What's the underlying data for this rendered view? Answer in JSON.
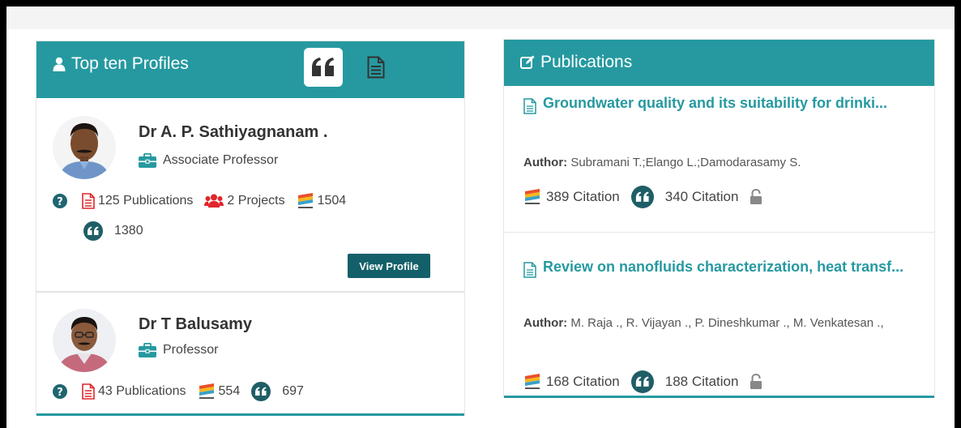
{
  "profiles_panel": {
    "title": "Top ten Profiles",
    "tabs": [
      "quote-tab",
      "document-tab"
    ],
    "profiles": [
      {
        "name": "Dr A. P. Sathiyagnanam .",
        "role": "Associate Professor",
        "publications": "125 Publications",
        "projects": "2 Projects",
        "dimensions_count": "1504",
        "citations_count": "1380",
        "button": "View Profile"
      },
      {
        "name": "Dr T Balusamy",
        "role": "Professor",
        "publications": "43 Publications",
        "dimensions_count": "554",
        "citations_count": "697"
      }
    ]
  },
  "publications_panel": {
    "title": "Publications",
    "items": [
      {
        "title": "Groundwater quality and its suitability for drinki...",
        "author_label": "Author:",
        "authors": "Subramani T.;Elango L.;Damodarasamy S.",
        "citation_a": "389 Citation",
        "citation_b": "340 Citation"
      },
      {
        "title": "Review on nanofluids characterization, heat transf...",
        "author_label": "Author:",
        "authors": "M. Raja ., R. Vijayan ., P. Dineshkumar ., M. Venkatesan .,",
        "citation_a": "168 Citation",
        "citation_b": "188 Citation"
      }
    ]
  },
  "colors": {
    "teal": "#2699a0",
    "dark_teal_button": "#14606a",
    "red_icon": "#e0262b"
  }
}
